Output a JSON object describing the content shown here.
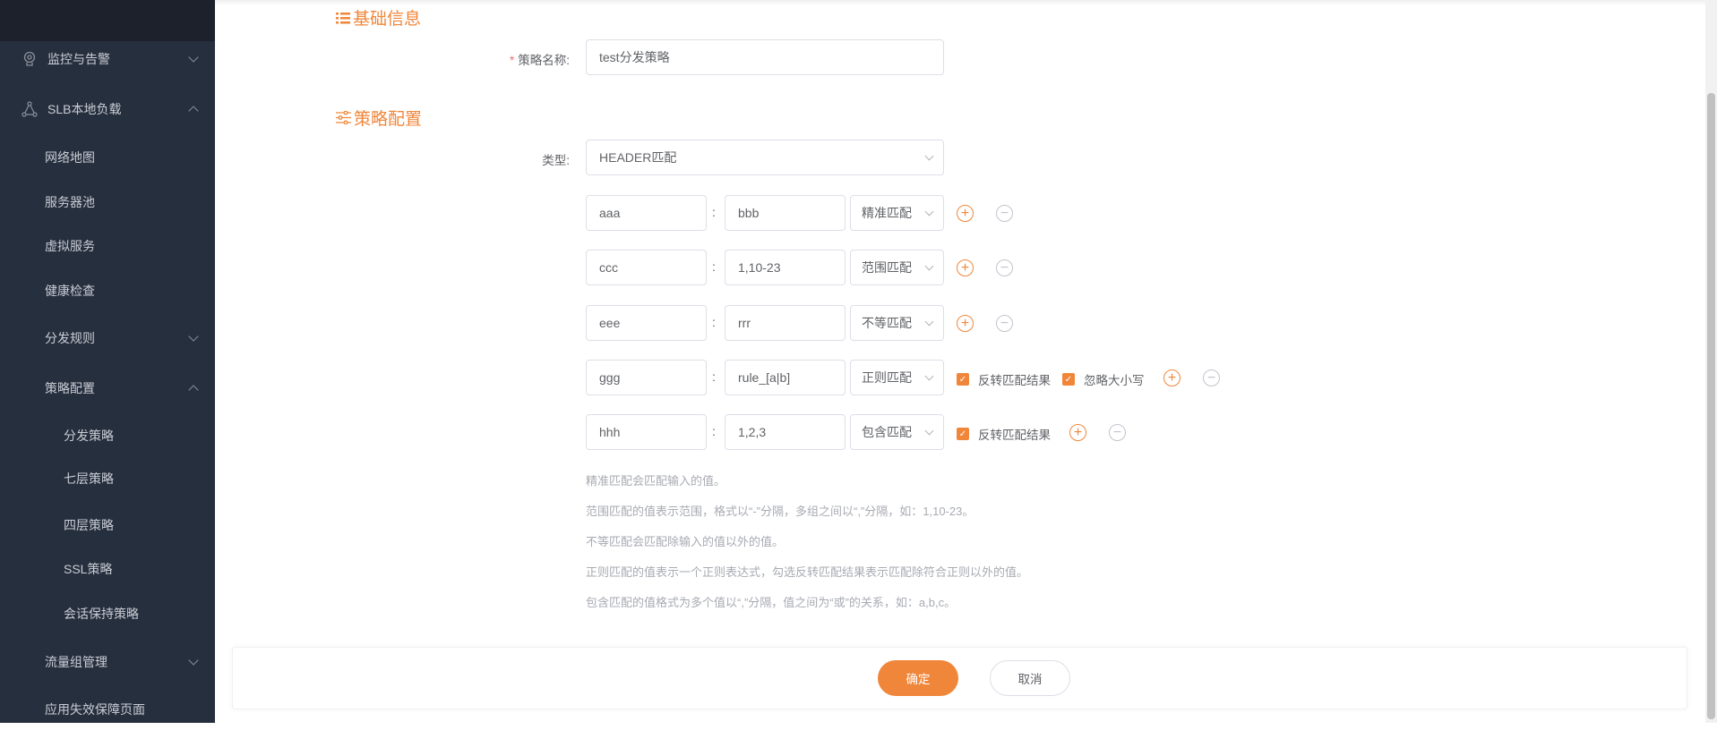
{
  "sidebar": {
    "items": [
      {
        "label": "监控与告警",
        "icon": "location-icon",
        "expand": "down"
      },
      {
        "label": "SLB本地负载",
        "icon": "network-icon",
        "expand": "up"
      },
      {
        "label": "网络地图"
      },
      {
        "label": "服务器池"
      },
      {
        "label": "虚拟服务"
      },
      {
        "label": "健康检查"
      },
      {
        "label": "分发规则",
        "expand": "down"
      },
      {
        "label": "策略配置",
        "expand": "up"
      },
      {
        "label": "分发策略"
      },
      {
        "label": "七层策略"
      },
      {
        "label": "四层策略"
      },
      {
        "label": "SSL策略"
      },
      {
        "label": "会话保持策略"
      },
      {
        "label": "流量组管理",
        "expand": "down"
      },
      {
        "label": "应用失效保障页面"
      }
    ]
  },
  "basic": {
    "title": "基础信息",
    "name_label": "策略名称:",
    "required_mark": "*",
    "name_value": "test分发策略"
  },
  "config": {
    "title": "策略配置",
    "type_label": "类型:",
    "type_value": "HEADER匹配",
    "colon": ":",
    "rules": [
      {
        "key": "aaa",
        "value": "bbb",
        "match": "精准匹配"
      },
      {
        "key": "ccc",
        "value": "1,10-23",
        "match": "范围匹配"
      },
      {
        "key": "eee",
        "value": "rrr",
        "match": "不等匹配"
      },
      {
        "key": "ggg",
        "value": "rule_[a|b]",
        "match": "正则匹配",
        "invert": "反转匹配结果",
        "invert_checked": true,
        "ignore_case": "忽略大小写",
        "ignore_case_checked": true
      },
      {
        "key": "hhh",
        "value": "1,2,3",
        "match": "包含匹配",
        "invert": "反转匹配结果",
        "invert_checked": true
      }
    ],
    "help": [
      "精准匹配会匹配输入的值。",
      "范围匹配的值表示范围，格式以“-”分隔，多组之间以“,”分隔，如：1,10-23。",
      "不等匹配会匹配除输入的值以外的值。",
      "正则匹配的值表示一个正则表达式，勾选反转匹配结果表示匹配除符合正则以外的值。",
      "包含匹配的值格式为多个值以“,”分隔，值之间为“或”的关系，如：a,b,c。"
    ]
  },
  "footer": {
    "confirm": "确定",
    "cancel": "取消"
  },
  "colors": {
    "accent": "#f0863a",
    "sidebar": "#262f3e"
  }
}
